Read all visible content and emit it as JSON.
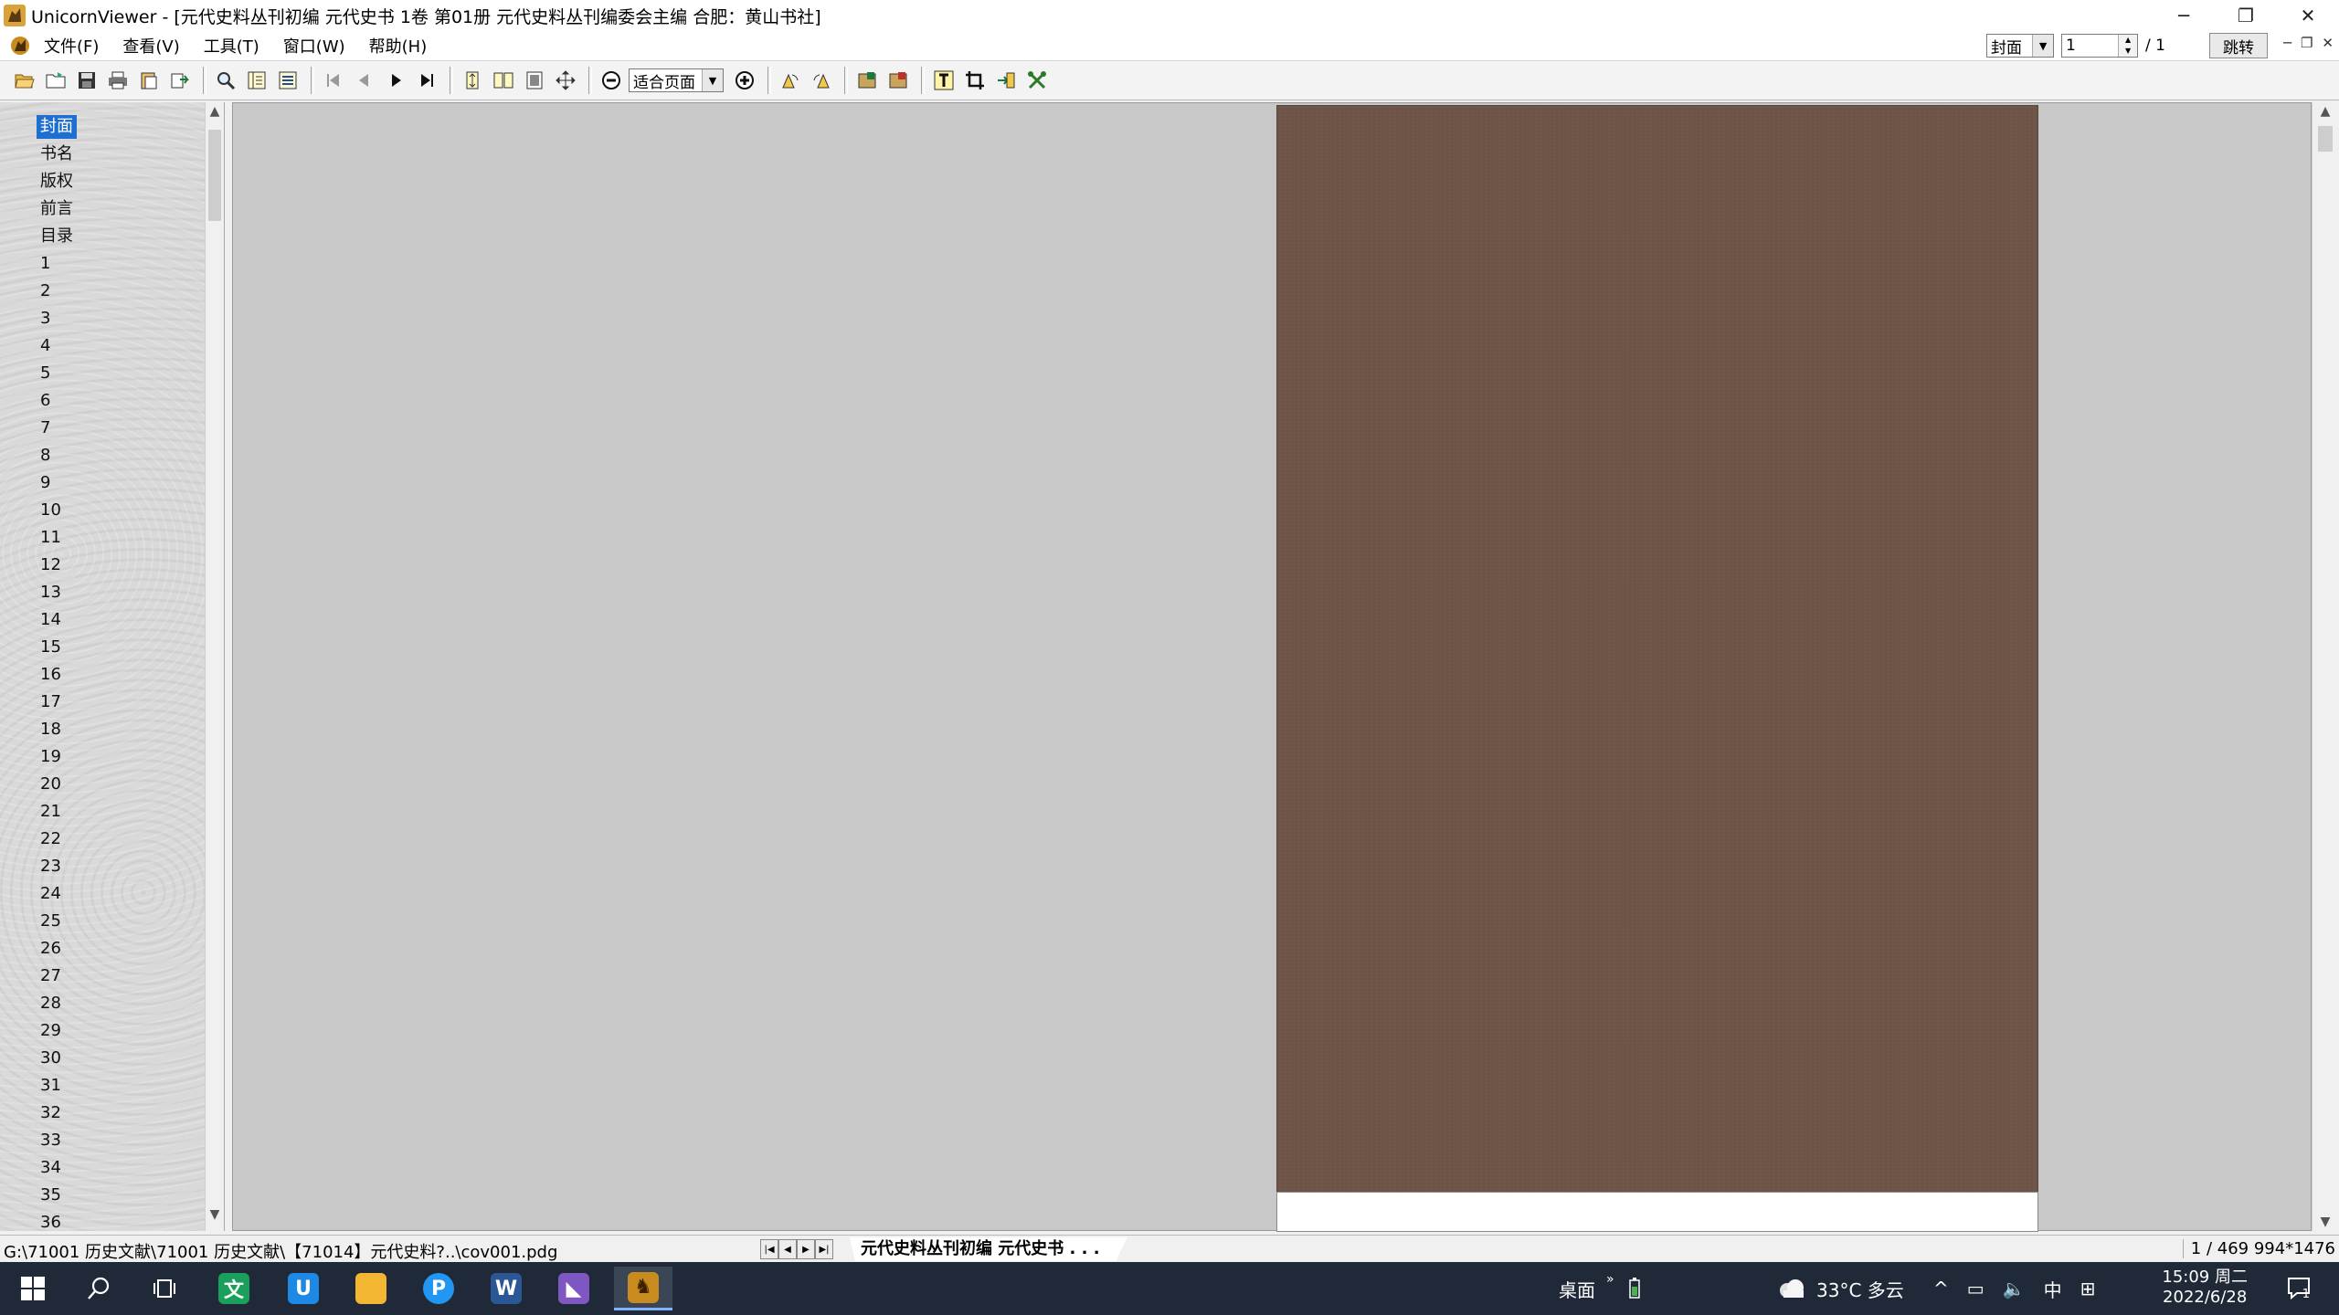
{
  "window": {
    "title": "UnicornViewer - [元代史料丛刊初编  元代史书  1卷 第01册 元代史料丛刊编委会主编 合肥：黄山书社]",
    "minimize": "─",
    "restore": "❐",
    "close": "✕"
  },
  "menu": {
    "items": [
      "文件(F)",
      "查看(V)",
      "工具(T)",
      "窗口(W)",
      "帮助(H)"
    ]
  },
  "goto": {
    "section_value": "封面",
    "page_value": "1",
    "total": "/ 1",
    "button": "跳转"
  },
  "toolbar": {
    "zoom_mode": "适合页面"
  },
  "sidebar": {
    "active_index": 0,
    "pages": [
      "封面",
      "书名",
      "版权",
      "前言",
      "目录",
      "1",
      "2",
      "3",
      "4",
      "5",
      "6",
      "7",
      "8",
      "9",
      "10",
      "11",
      "12",
      "13",
      "14",
      "15",
      "16",
      "17",
      "18",
      "19",
      "20",
      "21",
      "22",
      "23",
      "24",
      "25",
      "26",
      "27",
      "28",
      "29",
      "30",
      "31",
      "32",
      "33",
      "34",
      "35",
      "36"
    ]
  },
  "status": {
    "path": "G:\\71001 历史文献\\71001 历史文献\\【71014】元代史料?..\\cov001.pdg",
    "tab": "元代史料丛刊初编   元代史书  . . .",
    "page_info": "1 / 469 994*1476"
  },
  "taskbar": {
    "desktop_label": "桌面",
    "chevron": "»",
    "weather": "33°C  多云",
    "ime": "中",
    "clock_time": "15:09 周二",
    "clock_date": "2022/6/28",
    "notification_count": "1",
    "apps": [
      {
        "name": "start",
        "color": "#ffffff"
      },
      {
        "name": "search",
        "color": "#ffffff"
      },
      {
        "name": "task-view",
        "color": "#ffffff"
      },
      {
        "name": "wps-text",
        "color": "#1aa05a",
        "glyph": "文"
      },
      {
        "name": "browser",
        "color": "#1e88e5",
        "glyph": "U"
      },
      {
        "name": "file-explorer",
        "color": "#f2b632",
        "glyph": "▬"
      },
      {
        "name": "app-p",
        "color": "#2196f3",
        "glyph": "P"
      },
      {
        "name": "word",
        "color": "#2b5797",
        "glyph": "W"
      },
      {
        "name": "visual-studio",
        "color": "#7e57c2",
        "glyph": "◣"
      },
      {
        "name": "unicorn-viewer",
        "color": "#c98a1e",
        "glyph": "♞"
      }
    ]
  }
}
